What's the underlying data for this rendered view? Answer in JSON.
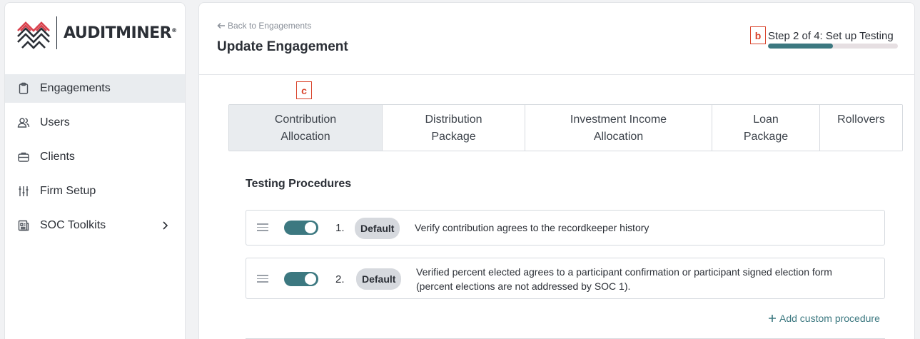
{
  "brand": {
    "name": "AUDITMINER",
    "trademark": "®",
    "colors": {
      "accent": "#3c7880",
      "logo_red": "#d9434f",
      "logo_dark": "#2b2f36"
    }
  },
  "sidebar": {
    "items": [
      {
        "label": "Engagements",
        "icon": "clipboard-icon",
        "active": true
      },
      {
        "label": "Users",
        "icon": "users-icon",
        "active": false
      },
      {
        "label": "Clients",
        "icon": "briefcase-icon",
        "active": false
      },
      {
        "label": "Firm Setup",
        "icon": "sliders-icon",
        "active": false
      },
      {
        "label": "SOC Toolkits",
        "icon": "document-icon",
        "active": false,
        "has_submenu": true
      }
    ]
  },
  "header": {
    "back_label": "Back to Engagements",
    "title": "Update Engagement",
    "step_label": "Step 2 of 4: Set up Testing",
    "progress_fraction": 0.5
  },
  "markers": {
    "b": "b",
    "c": "c"
  },
  "tabs": [
    {
      "line1": "Contribution",
      "line2": "Allocation",
      "active": true
    },
    {
      "line1": "Distribution",
      "line2": "Package",
      "active": false
    },
    {
      "line1": "Investment Income",
      "line2": "Allocation",
      "active": false
    },
    {
      "line1": "Loan",
      "line2": "Package",
      "active": false
    },
    {
      "line1": "Rollovers",
      "line2": "",
      "active": false
    }
  ],
  "testing": {
    "title": "Testing Procedures",
    "procedures": [
      {
        "number": "1.",
        "badge": "Default",
        "enabled": true,
        "text_line1": "Verify contribution agrees to the recordkeeper history",
        "text_line2": ""
      },
      {
        "number": "2.",
        "badge": "Default",
        "enabled": true,
        "text_line1": "Verified percent elected agrees to a participant confirmation or participant signed election form",
        "text_line2": "(percent elections are not addressed by SOC 1)."
      }
    ],
    "add_label": "Add custom procedure"
  }
}
